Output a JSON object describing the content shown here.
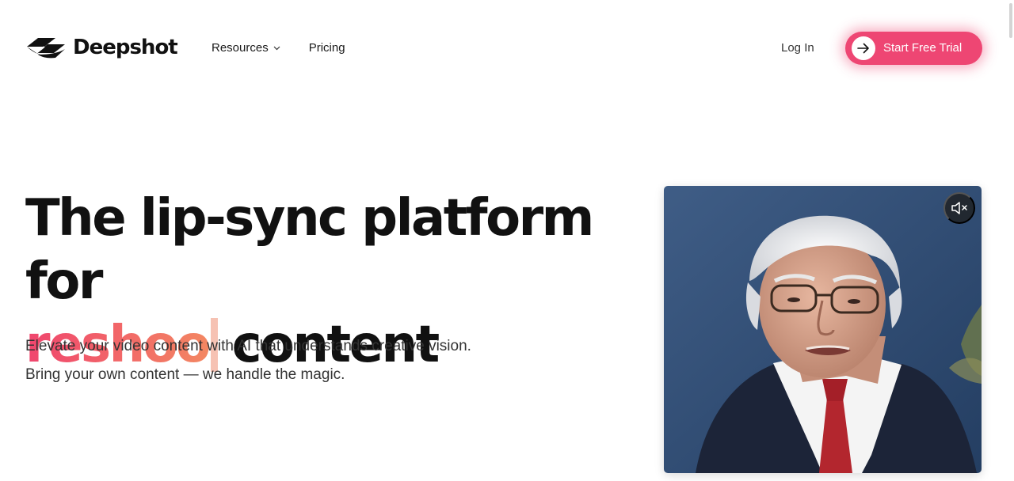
{
  "brand": {
    "name": "Deepshot",
    "accent_color": "#ee4673",
    "gradient": [
      "#f0456e",
      "#f38762"
    ]
  },
  "nav": {
    "items": [
      {
        "label": "Resources",
        "icon": "chevron-down-icon"
      },
      {
        "label": "Pricing"
      }
    ],
    "login_label": "Log In",
    "cta_label": "Start Free Trial",
    "cta_icon": "arrow-right-icon"
  },
  "hero": {
    "title_line1": "The lip-sync platform for",
    "typed_word": "reshoo",
    "title_line2_suffix": "content",
    "subtitle_line1": "Elevate your video content with AI that understands creative vision.",
    "subtitle_line2": "Bring your own content — we handle the magic."
  },
  "video": {
    "mute_icon": "speaker-muted-icon"
  }
}
